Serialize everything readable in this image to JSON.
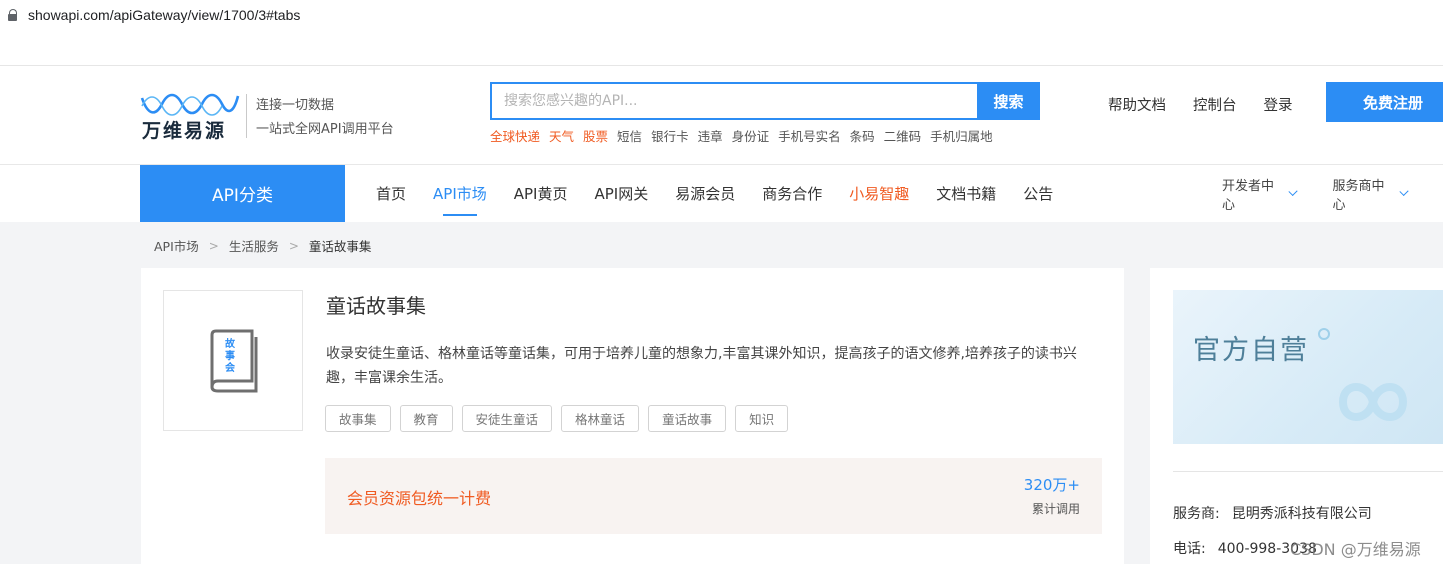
{
  "browser": {
    "url": "showapi.com/apiGateway/view/1700/3#tabs"
  },
  "header": {
    "logo": {
      "brand": "万维易源",
      "slogan_line1": "连接一切数据",
      "slogan_line2": "一站式全网API调用平台"
    },
    "search": {
      "placeholder": "搜索您感兴趣的API...",
      "button_label": "搜索"
    },
    "hotwords": [
      {
        "label": "全球快递",
        "hot": true
      },
      {
        "label": "天气",
        "hot": true
      },
      {
        "label": "股票",
        "hot": true
      },
      {
        "label": "短信",
        "hot": false
      },
      {
        "label": "银行卡",
        "hot": false
      },
      {
        "label": "违章",
        "hot": false
      },
      {
        "label": "身份证",
        "hot": false
      },
      {
        "label": "手机号实名",
        "hot": false
      },
      {
        "label": "条码",
        "hot": false
      },
      {
        "label": "二维码",
        "hot": false
      },
      {
        "label": "手机归属地",
        "hot": false
      }
    ],
    "links": {
      "help": "帮助文档",
      "console": "控制台",
      "login": "登录"
    },
    "register_label": "免费注册"
  },
  "nav": {
    "category_label": "API分类",
    "items": [
      {
        "label": "首页",
        "state": "normal"
      },
      {
        "label": "API市场",
        "state": "active"
      },
      {
        "label": "API黄页",
        "state": "normal"
      },
      {
        "label": "API网关",
        "state": "normal"
      },
      {
        "label": "易源会员",
        "state": "normal"
      },
      {
        "label": "商务合作",
        "state": "normal"
      },
      {
        "label": "小易智趣",
        "state": "highlight"
      },
      {
        "label": "文档书籍",
        "state": "normal"
      },
      {
        "label": "公告",
        "state": "normal"
      }
    ],
    "dev_center": "开发者中心",
    "provider_center": "服务商中心"
  },
  "breadcrumb": {
    "items": [
      "API市场",
      "生活服务",
      "童话故事集"
    ],
    "separator": ">"
  },
  "product": {
    "icon_text": [
      "故",
      "事",
      "会"
    ],
    "title": "童话故事集",
    "description": "收录安徒生童话、格林童话等童话集，可用于培养儿童的想象力,丰富其课外知识，提高孩子的语文修养,培养孩子的读书兴趣，丰富课余生活。",
    "tags": [
      "故事集",
      "教育",
      "安徒生童话",
      "格林童话",
      "童话故事",
      "知识"
    ],
    "pricing_label": "会员资源包统一计费",
    "calls_value": "320万+",
    "calls_caption": "累计调用"
  },
  "sidebar": {
    "banner_text": "官方自营",
    "provider_label": "服务商:",
    "provider_name": "昆明秀派科技有限公司",
    "phone_label": "电话:",
    "phone_value": "400-998-3038"
  },
  "watermark": "CSDN @万维易源",
  "colors": {
    "accent": "#2c8df4",
    "highlight": "#f05b22",
    "price_bg": "#f8f3f1"
  }
}
